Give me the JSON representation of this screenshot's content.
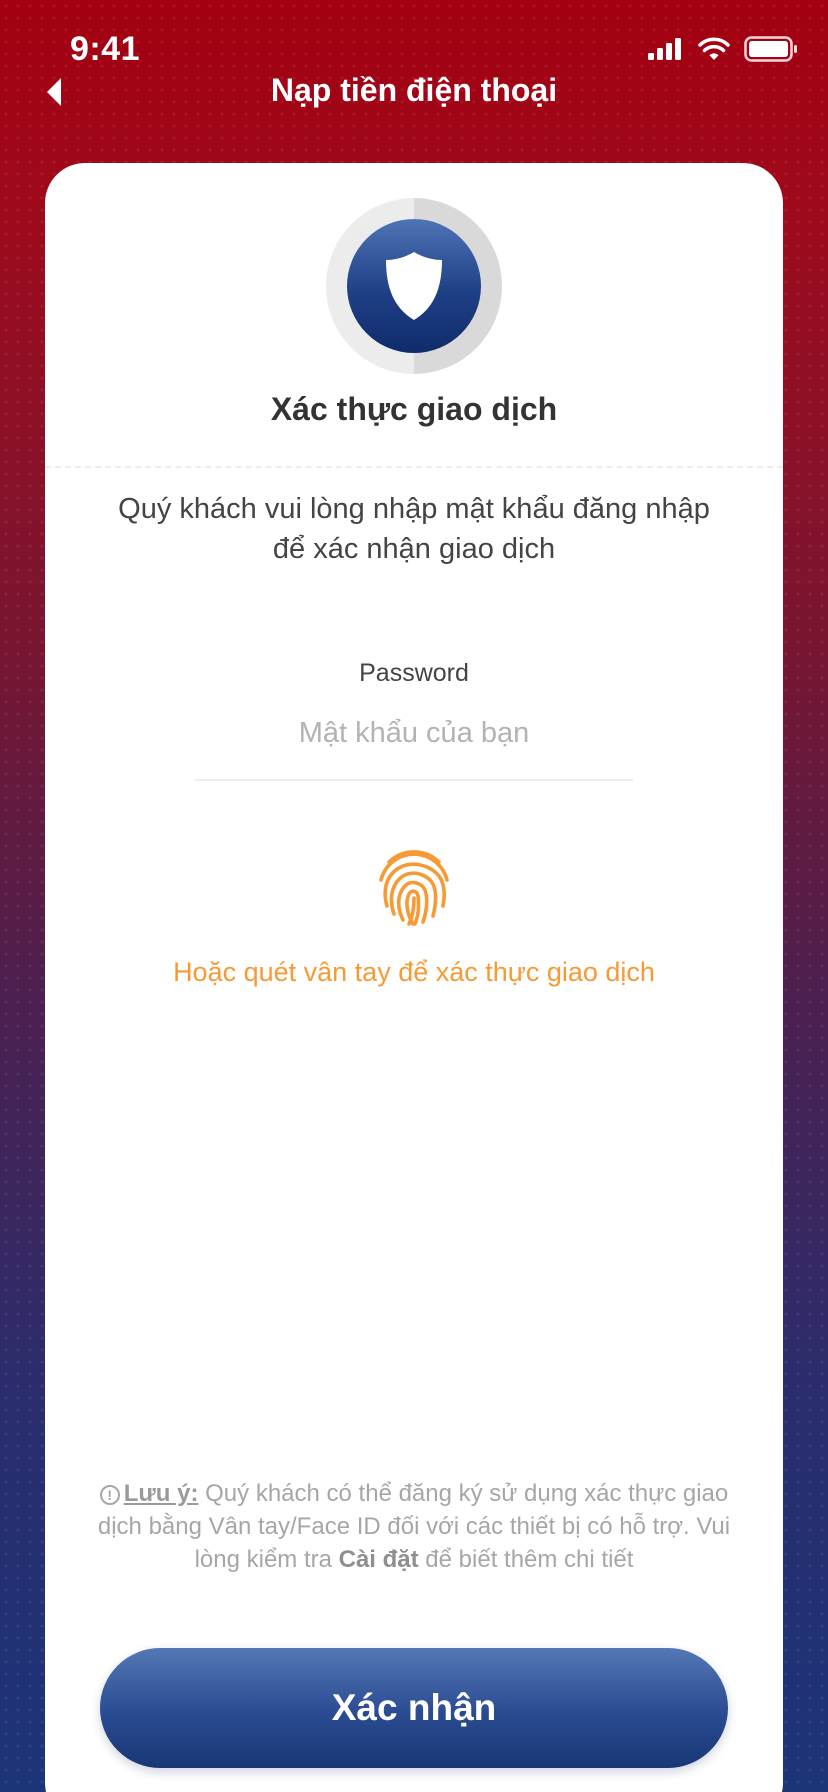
{
  "status_bar": {
    "time": "9:41",
    "icons": [
      "signal-icon",
      "wifi-icon",
      "battery-icon"
    ]
  },
  "nav": {
    "title": "Nạp tiền điện thoại",
    "back_icon": "chevron-left-icon"
  },
  "card": {
    "icon": "shield-icon",
    "title": "Xác thực giao dịch",
    "instruction_line1": "Quý khách vui lòng nhập mật khẩu đăng nhập",
    "instruction_line2": "để xác nhận giao dịch",
    "password": {
      "label": "Password",
      "placeholder": "Mật khẩu của bạn",
      "value": ""
    },
    "fingerprint": {
      "icon": "fingerprint-icon",
      "hint": "Hoặc quét vân tay để xác thực giao dịch"
    },
    "note": {
      "icon": "info-icon",
      "label": "Lưu ý:",
      "text_before": " Quý khách có thể đăng ký sử dụng xác thực giao dịch bằng Vân tay/Face ID đối với các thiết bị có hỗ trợ. Vui lòng kiểm tra ",
      "bold": "Cài đặt",
      "text_after": " để biết thêm chi tiết"
    },
    "confirm_label": "Xác nhận"
  },
  "colors": {
    "header_red": "#a30010",
    "accent_orange": "#f79a35",
    "button_blue": "#2a4b91"
  }
}
